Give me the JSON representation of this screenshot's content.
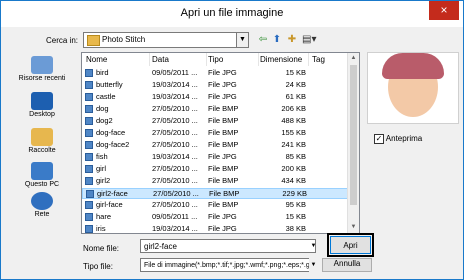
{
  "window": {
    "title": "Apri un file immagine",
    "close_glyph": "×"
  },
  "lookin": {
    "label": "Cerca in:",
    "value": "Photo Stitch"
  },
  "toolbar": {
    "back_icon": "back-arrow-icon",
    "up_icon": "up-folder-icon",
    "new_folder_icon": "new-folder-icon",
    "view_icon": "view-menu-icon"
  },
  "places": [
    {
      "label": "Risorse recenti",
      "icon": "recent-places-icon"
    },
    {
      "label": "Desktop",
      "icon": "desktop-icon"
    },
    {
      "label": "Raccolte",
      "icon": "libraries-icon"
    },
    {
      "label": "Questo PC",
      "icon": "computer-icon"
    },
    {
      "label": "Rete",
      "icon": "network-icon"
    }
  ],
  "columns": {
    "name": "Nome",
    "date": "Data",
    "type": "Tipo",
    "size": "Dimensione",
    "tag": "Tag"
  },
  "files": [
    {
      "name": "bird",
      "date": "09/05/2011 ...",
      "type": "File JPG",
      "size": "15 KB"
    },
    {
      "name": "butterfly",
      "date": "19/03/2014 ...",
      "type": "File JPG",
      "size": "24 KB"
    },
    {
      "name": "castle",
      "date": "19/03/2014 ...",
      "type": "File JPG",
      "size": "61 KB"
    },
    {
      "name": "dog",
      "date": "27/05/2010 ...",
      "type": "File BMP",
      "size": "206 KB"
    },
    {
      "name": "dog2",
      "date": "27/05/2010 ...",
      "type": "File BMP",
      "size": "488 KB"
    },
    {
      "name": "dog-face",
      "date": "27/05/2010 ...",
      "type": "File BMP",
      "size": "155 KB"
    },
    {
      "name": "dog-face2",
      "date": "27/05/2010 ...",
      "type": "File BMP",
      "size": "241 KB"
    },
    {
      "name": "fish",
      "date": "19/03/2014 ...",
      "type": "File JPG",
      "size": "85 KB"
    },
    {
      "name": "girl",
      "date": "27/05/2010 ...",
      "type": "File BMP",
      "size": "200 KB"
    },
    {
      "name": "girl2",
      "date": "27/05/2010 ...",
      "type": "File BMP",
      "size": "434 KB"
    },
    {
      "name": "girl2-face",
      "date": "27/05/2010 ...",
      "type": "File BMP",
      "size": "229 KB",
      "selected": true
    },
    {
      "name": "girl-face",
      "date": "27/05/2010 ...",
      "type": "File BMP",
      "size": "95 KB"
    },
    {
      "name": "hare",
      "date": "09/05/2011 ...",
      "type": "File JPG",
      "size": "15 KB"
    },
    {
      "name": "iris",
      "date": "19/03/2014 ...",
      "type": "File JPG",
      "size": "38 KB"
    }
  ],
  "preview": {
    "checkbox_label": "Anteprima",
    "checked": true,
    "check_glyph": "✓"
  },
  "filename": {
    "label": "Nome file:",
    "value": "girl2-face"
  },
  "filetype": {
    "label": "Tipo file:",
    "value": "File di immagine(*.bmp;*.tif;*.jpg;*.wmf;*.png;*.eps;*.gif"
  },
  "buttons": {
    "open": "Apri",
    "cancel": "Annulla"
  }
}
